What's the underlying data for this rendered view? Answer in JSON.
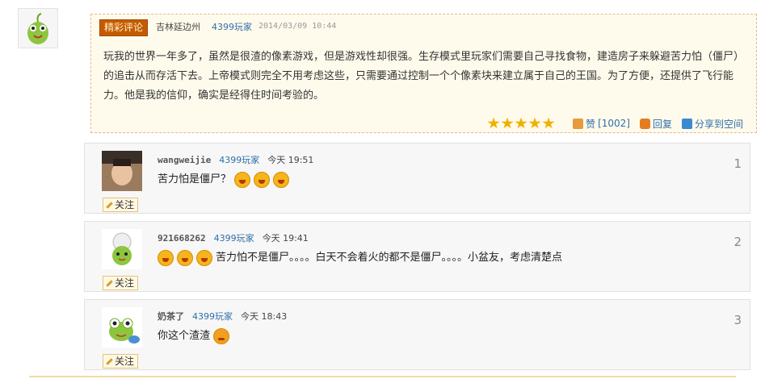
{
  "featured": {
    "badge": "精彩评论",
    "region": "吉林延边州",
    "player_tag": "4399玩家",
    "date": "2014/03/09 10:44",
    "text": "玩我的世界一年多了，虽然是很渣的像素游戏，但是游戏性却很强。生存模式里玩家们需要自己寻找食物，建造房子来躲避苦力怕（僵尸）的追击从而存活下去。上帝模式则完全不用考虑这些，只需要通过控制一个个像素块来建立属于自己的王国。为了方便，还提供了飞行能力。他是我的信仰，确实是经得住时间考验的。",
    "stars": 5,
    "like_label": "赞",
    "like_count": "[1002]",
    "reply_label": "回复",
    "share_label": "分享到空间"
  },
  "replies": [
    {
      "user": "wangweijie",
      "tag": "4399玩家",
      "time": "今天 19:51",
      "text": "苦力怕是僵尸？",
      "emoji_after": 3,
      "emoji_before": 0,
      "number": "1",
      "follow": "关注"
    },
    {
      "user": "921668262",
      "tag": "4399玩家",
      "time": "今天 19:41",
      "text": "苦力怕不是僵尸。。。。白天不会着火的都不是僵尸。。。。小盆友，考虑清楚点",
      "emoji_after": 0,
      "emoji_before": 3,
      "number": "2",
      "follow": "关注"
    },
    {
      "user": "奶茶了",
      "tag": "4399玩家",
      "time": "今天 18:43",
      "text": "你这个渣渣",
      "emoji_after": 1,
      "emoji_before": 0,
      "number": "3",
      "follow": "关注"
    }
  ],
  "colors": {
    "accent": "#c45b00",
    "link": "#2f6ea8",
    "star": "#f0b000"
  }
}
